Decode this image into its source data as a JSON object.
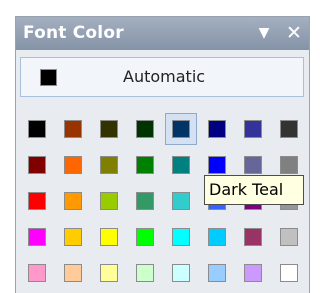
{
  "window": {
    "title": "Font Color",
    "dropdown_glyph": "▼",
    "close_glyph": "✕"
  },
  "automatic": {
    "label": "Automatic",
    "color": "#000000"
  },
  "palette": {
    "rows": [
      [
        "#000000",
        "#993300",
        "#333300",
        "#003300",
        "#003366",
        "#000080",
        "#333399",
        "#333333"
      ],
      [
        "#800000",
        "#ff6600",
        "#808000",
        "#008000",
        "#008080",
        "#0000ff",
        "#666699",
        "#808080"
      ],
      [
        "#ff0000",
        "#ff9900",
        "#99cc00",
        "#339966",
        "#33cccc",
        "#3366ff",
        "#800080",
        "#969696"
      ],
      [
        "#ff00ff",
        "#ffcc00",
        "#ffff00",
        "#00ff00",
        "#00ffff",
        "#00ccff",
        "#993366",
        "#c0c0c0"
      ],
      [
        "#ff99cc",
        "#ffcc99",
        "#ffff99",
        "#ccffcc",
        "#ccffff",
        "#99ccff",
        "#cc99ff",
        "#ffffff"
      ]
    ],
    "selected": {
      "row": 0,
      "col": 4
    }
  },
  "tooltip": {
    "text": "Dark Teal"
  }
}
